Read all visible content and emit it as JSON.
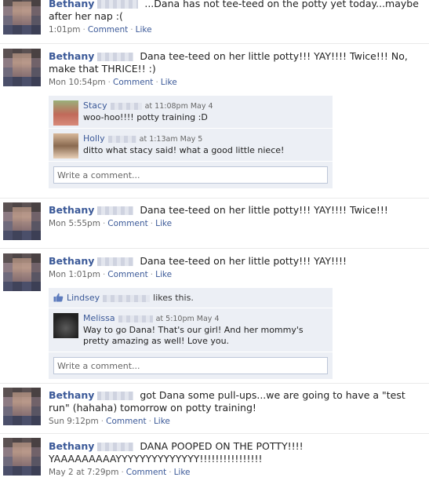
{
  "posts": [
    {
      "name": "Bethany",
      "text": "...Dana has not tee-teed on the potty yet today...maybe after her nap :(",
      "time": "1:01pm",
      "comment_label": "Comment",
      "like_label": "Like"
    },
    {
      "name": "Bethany",
      "text": "Dana tee-teed on her little potty!!! YAY!!!! Twice!!! No, make that THRICE!! :)",
      "time": "Mon 10:54pm",
      "comment_label": "Comment",
      "like_label": "Like",
      "comments": [
        {
          "name": "Stacy",
          "time": "at 11:08pm May 4",
          "text": "woo-hoo!!!! potty training :D"
        },
        {
          "name": "Holly",
          "time": "at 1:13am May 5",
          "text": "ditto what stacy said! what a good little niece!"
        }
      ],
      "write_placeholder": "Write a comment..."
    },
    {
      "name": "Bethany",
      "text": "Dana tee-teed on her little potty!!! YAY!!!! Twice!!!",
      "time": "Mon 5:55pm",
      "comment_label": "Comment",
      "like_label": "Like"
    },
    {
      "name": "Bethany",
      "text": "Dana tee-teed on her little potty!!! YAY!!!!",
      "time": "Mon 1:01pm",
      "comment_label": "Comment",
      "like_label": "Like",
      "likes_name": "Lindsey",
      "likes_text": "likes this.",
      "comments": [
        {
          "name": "Melissa",
          "time": "at 5:10pm May 4",
          "text": "Way to go Dana! That's our girl! And her mommy's pretty amazing as well! Love you."
        }
      ],
      "write_placeholder": "Write a comment..."
    },
    {
      "name": "Bethany",
      "text": "got Dana some pull-ups...we are going to have a \"test run\" (hahaha) tomorrow on potty training!",
      "time": "Sun 9:12pm",
      "comment_label": "Comment",
      "like_label": "Like"
    },
    {
      "name": "Bethany",
      "text": "DANA POOPED ON THE POTTY!!!! YAAAAAAAAAYYYYYYYYYYYYYY!!!!!!!!!!!!!!!!",
      "time": "May 2 at 7:29pm",
      "comment_label": "Comment",
      "like_label": "Like"
    }
  ],
  "colors": {
    "link": "#3b5998",
    "comment_bg": "#eceff5"
  },
  "icons": {
    "like": "thumbs-up-icon"
  }
}
